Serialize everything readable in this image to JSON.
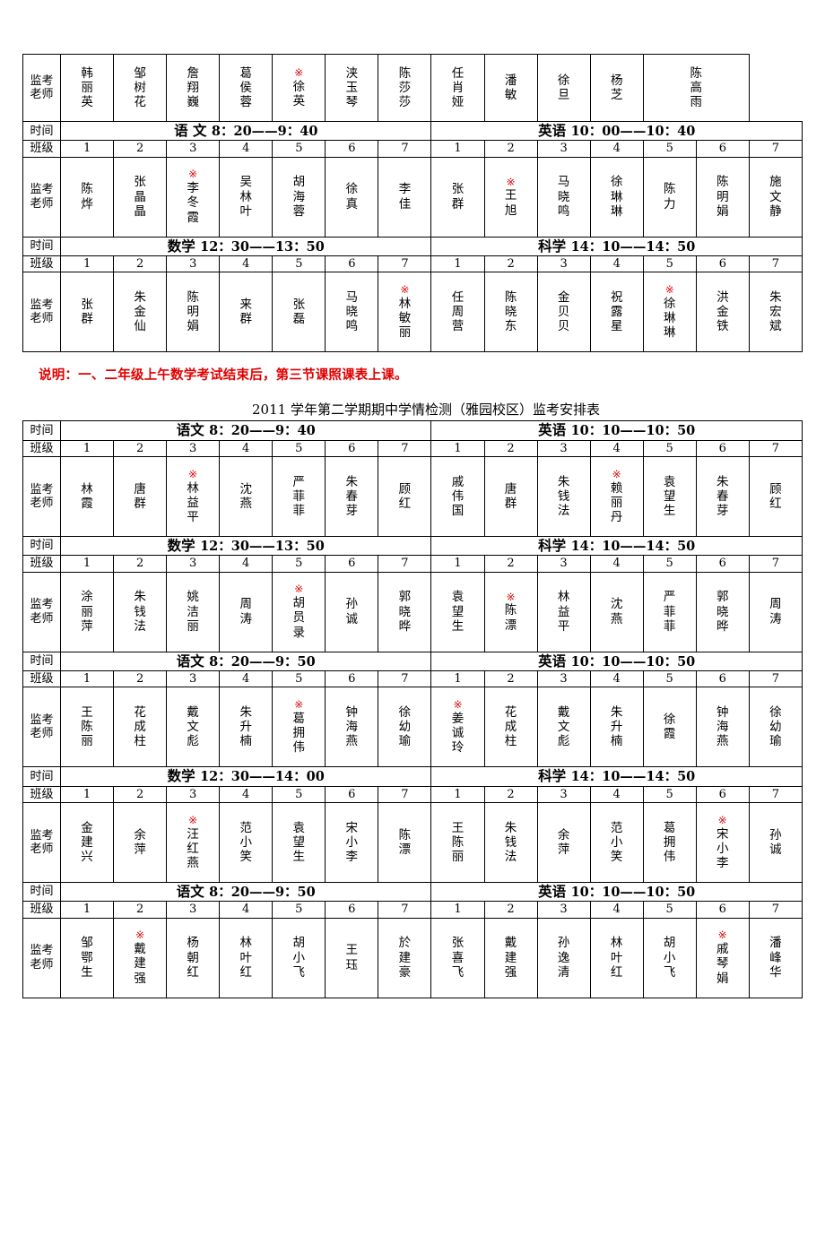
{
  "document": {
    "note": "说明：一、二年级上午数学考试结束后，第三节课照课表上课。",
    "note_color": "#e00000",
    "second_table_title": "2011 学年第二学期期中学情检测（雅园校区）监考安排表",
    "mark_symbol": "※",
    "mark_color": "#d81010"
  },
  "labels": {
    "time": "时间",
    "class": "班级",
    "proctor": "监考老师"
  },
  "table1": {
    "top_row": {
      "label": "监考老师",
      "cells": [
        {
          "mark": false,
          "name": "韩丽英"
        },
        {
          "mark": false,
          "name": "邹树花"
        },
        {
          "mark": false,
          "name": "詹翔巍"
        },
        {
          "mark": false,
          "name": "葛侯蓉"
        },
        {
          "mark": true,
          "name": "徐英"
        },
        {
          "mark": false,
          "name": "浃玉琴"
        },
        {
          "mark": false,
          "name": "陈莎莎"
        },
        {
          "mark": false,
          "name": "任肖娅"
        },
        {
          "mark": false,
          "name": "潘敏"
        },
        {
          "mark": false,
          "name": "徐旦"
        },
        {
          "mark": false,
          "name": "杨芝"
        },
        {
          "mark": false,
          "name": "陈高雨"
        }
      ]
    },
    "blocks": [
      {
        "time_left": {
          "subject": "语  文",
          "time": "8：20——9：40"
        },
        "time_right": {
          "subject": "英语",
          "time": "10：00——10：40"
        },
        "classes": [
          "1",
          "2",
          "3",
          "4",
          "5",
          "6",
          "7",
          "1",
          "2",
          "3",
          "4",
          "5",
          "6",
          "7"
        ],
        "teachers": [
          {
            "mark": false,
            "name": "陈烨"
          },
          {
            "mark": false,
            "name": "张晶晶"
          },
          {
            "mark": true,
            "name": "李冬霞"
          },
          {
            "mark": false,
            "name": "吴林叶"
          },
          {
            "mark": false,
            "name": "胡海蓉"
          },
          {
            "mark": false,
            "name": "徐真"
          },
          {
            "mark": false,
            "name": "李佳"
          },
          {
            "mark": false,
            "name": "张群"
          },
          {
            "mark": true,
            "name": "王旭"
          },
          {
            "mark": false,
            "name": "马晓鸣"
          },
          {
            "mark": false,
            "name": "徐琳琳"
          },
          {
            "mark": false,
            "name": "陈力"
          },
          {
            "mark": false,
            "name": "陈明娟"
          },
          {
            "mark": false,
            "name": "施文静"
          }
        ]
      },
      {
        "time_left": {
          "subject": "数学",
          "time": "12：30——13：50"
        },
        "time_right": {
          "subject": "科学",
          "time": "14：10——14：50"
        },
        "classes": [
          "1",
          "2",
          "3",
          "4",
          "5",
          "6",
          "7",
          "1",
          "2",
          "3",
          "4",
          "5",
          "6",
          "7"
        ],
        "teachers": [
          {
            "mark": false,
            "name": "张群"
          },
          {
            "mark": false,
            "name": "朱金仙"
          },
          {
            "mark": false,
            "name": "陈明娟"
          },
          {
            "mark": false,
            "name": "来群"
          },
          {
            "mark": false,
            "name": "张磊"
          },
          {
            "mark": false,
            "name": "马晓鸣"
          },
          {
            "mark": true,
            "name": "林敏丽"
          },
          {
            "mark": false,
            "name": "任周营"
          },
          {
            "mark": false,
            "name": "陈晓东"
          },
          {
            "mark": false,
            "name": "金贝贝"
          },
          {
            "mark": false,
            "name": "祝露星"
          },
          {
            "mark": true,
            "name": "徐琳琳"
          },
          {
            "mark": false,
            "name": "洪金铁"
          },
          {
            "mark": false,
            "name": "朱宏斌"
          }
        ]
      }
    ]
  },
  "table2": {
    "blocks": [
      {
        "time_left": {
          "subject": "语文",
          "time": "8：20——9：40"
        },
        "time_right": {
          "subject": "英语",
          "time": "10：10——10：50"
        },
        "classes": [
          "1",
          "2",
          "3",
          "4",
          "5",
          "6",
          "7",
          "1",
          "2",
          "3",
          "4",
          "5",
          "6",
          "7"
        ],
        "teachers": [
          {
            "mark": false,
            "name": "林霞"
          },
          {
            "mark": false,
            "name": "唐群"
          },
          {
            "mark": true,
            "name": "林益平"
          },
          {
            "mark": false,
            "name": "沈燕"
          },
          {
            "mark": false,
            "name": "严菲菲"
          },
          {
            "mark": false,
            "name": "朱春芽"
          },
          {
            "mark": false,
            "name": "顾红"
          },
          {
            "mark": false,
            "name": "戚伟国"
          },
          {
            "mark": false,
            "name": "唐群"
          },
          {
            "mark": false,
            "name": "朱钱法"
          },
          {
            "mark": true,
            "name": "赖丽丹"
          },
          {
            "mark": false,
            "name": "袁望生"
          },
          {
            "mark": false,
            "name": "朱春芽"
          },
          {
            "mark": false,
            "name": "顾红"
          }
        ]
      },
      {
        "time_left": {
          "subject": "数学",
          "time": "12：30——13：50"
        },
        "time_right": {
          "subject": "科学",
          "time": "14：10——14：50"
        },
        "classes": [
          "1",
          "2",
          "3",
          "4",
          "5",
          "6",
          "7",
          "1",
          "2",
          "3",
          "4",
          "5",
          "6",
          "7"
        ],
        "teachers": [
          {
            "mark": false,
            "name": "涂丽萍"
          },
          {
            "mark": false,
            "name": "朱钱法"
          },
          {
            "mark": false,
            "name": "姚洁丽"
          },
          {
            "mark": false,
            "name": "周涛"
          },
          {
            "mark": true,
            "name": "胡员录"
          },
          {
            "mark": false,
            "name": "孙诚"
          },
          {
            "mark": false,
            "name": "郭晓晔"
          },
          {
            "mark": false,
            "name": "袁望生"
          },
          {
            "mark": true,
            "name": "陈漂"
          },
          {
            "mark": false,
            "name": "林益平"
          },
          {
            "mark": false,
            "name": "沈燕"
          },
          {
            "mark": false,
            "name": "严菲菲"
          },
          {
            "mark": false,
            "name": "郭晓晔"
          },
          {
            "mark": false,
            "name": "周涛"
          }
        ]
      },
      {
        "time_left": {
          "subject": "语文",
          "time": "8：20——9：50"
        },
        "time_right": {
          "subject": "英语",
          "time": "10：10——10：50"
        },
        "classes": [
          "1",
          "2",
          "3",
          "4",
          "5",
          "6",
          "7",
          "1",
          "2",
          "3",
          "4",
          "5",
          "6",
          "7"
        ],
        "teachers": [
          {
            "mark": false,
            "name": "王陈丽"
          },
          {
            "mark": false,
            "name": "花成柱"
          },
          {
            "mark": false,
            "name": "戴文彪"
          },
          {
            "mark": false,
            "name": "朱升楠"
          },
          {
            "mark": true,
            "name": "葛拥伟"
          },
          {
            "mark": false,
            "name": "钟海燕"
          },
          {
            "mark": false,
            "name": "徐幼瑜"
          },
          {
            "mark": true,
            "name": "姜诚玲"
          },
          {
            "mark": false,
            "name": "花成柱"
          },
          {
            "mark": false,
            "name": "戴文彪"
          },
          {
            "mark": false,
            "name": "朱升楠"
          },
          {
            "mark": false,
            "name": "徐霞"
          },
          {
            "mark": false,
            "name": "钟海燕"
          },
          {
            "mark": false,
            "name": "徐幼瑜"
          }
        ]
      },
      {
        "time_left": {
          "subject": "数学",
          "time": "12：30——14：00"
        },
        "time_right": {
          "subject": "科学",
          "time": "14：10——14：50"
        },
        "classes": [
          "1",
          "2",
          "3",
          "4",
          "5",
          "6",
          "7",
          "1",
          "2",
          "3",
          "4",
          "5",
          "6",
          "7"
        ],
        "teachers": [
          {
            "mark": false,
            "name": "金建兴"
          },
          {
            "mark": false,
            "name": "余萍"
          },
          {
            "mark": true,
            "name": "汪红燕"
          },
          {
            "mark": false,
            "name": "范小笑"
          },
          {
            "mark": false,
            "name": "袁望生"
          },
          {
            "mark": false,
            "name": "宋小李"
          },
          {
            "mark": false,
            "name": "陈漂"
          },
          {
            "mark": false,
            "name": "王陈丽"
          },
          {
            "mark": false,
            "name": "朱钱法"
          },
          {
            "mark": false,
            "name": "余萍"
          },
          {
            "mark": false,
            "name": "范小笑"
          },
          {
            "mark": false,
            "name": "葛拥伟"
          },
          {
            "mark": true,
            "name": "宋小李"
          },
          {
            "mark": false,
            "name": "孙诚"
          }
        ]
      },
      {
        "time_left": {
          "subject": "语文",
          "time": "8：20——9：50"
        },
        "time_right": {
          "subject": "英语",
          "time": "10：10——10：50"
        },
        "classes": [
          "1",
          "2",
          "3",
          "4",
          "5",
          "6",
          "7",
          "1",
          "2",
          "3",
          "4",
          "5",
          "6",
          "7"
        ],
        "teachers": [
          {
            "mark": false,
            "name": "邹鄂生"
          },
          {
            "mark": true,
            "name": "戴建强"
          },
          {
            "mark": false,
            "name": "杨朝红"
          },
          {
            "mark": false,
            "name": "林叶红"
          },
          {
            "mark": false,
            "name": "胡小飞"
          },
          {
            "mark": false,
            "name": "王珏"
          },
          {
            "mark": false,
            "name": "於建豪"
          },
          {
            "mark": false,
            "name": "张喜飞"
          },
          {
            "mark": false,
            "name": "戴建强"
          },
          {
            "mark": false,
            "name": "孙逸清"
          },
          {
            "mark": false,
            "name": "林叶红"
          },
          {
            "mark": false,
            "name": "胡小飞"
          },
          {
            "mark": true,
            "name": "戚琴娟"
          },
          {
            "mark": false,
            "name": "潘峰华"
          }
        ]
      }
    ]
  }
}
